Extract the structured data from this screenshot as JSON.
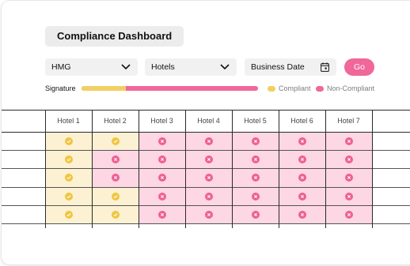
{
  "title": "Compliance Dashboard",
  "filters": {
    "brand": "HMG",
    "property": "Hotels",
    "date_placeholder": "Business Date"
  },
  "go_label": "Go",
  "signature": {
    "label": "Signature",
    "compliant_fraction": 0.25
  },
  "legend": {
    "compliant": "Compliant",
    "non_compliant": "Non-Compliant"
  },
  "colors": {
    "compliant": "#f2cf63",
    "non_compliant": "#f0679a",
    "compliant_bg": "#fcf1d2",
    "non_compliant_bg": "#fdd7e3"
  },
  "table": {
    "columns": [
      "Hotel 1",
      "Hotel 2",
      "Hotel 3",
      "Hotel 4",
      "Hotel 5",
      "Hotel 6",
      "Hotel 7"
    ],
    "rows": [
      [
        "compliant",
        "compliant",
        "non_compliant",
        "non_compliant",
        "non_compliant",
        "non_compliant",
        "non_compliant"
      ],
      [
        "compliant",
        "non_compliant",
        "non_compliant",
        "non_compliant",
        "non_compliant",
        "non_compliant",
        "non_compliant"
      ],
      [
        "compliant",
        "non_compliant",
        "non_compliant",
        "non_compliant",
        "non_compliant",
        "non_compliant",
        "non_compliant"
      ],
      [
        "compliant",
        "compliant",
        "non_compliant",
        "non_compliant",
        "non_compliant",
        "non_compliant",
        "non_compliant"
      ],
      [
        "compliant",
        "compliant",
        "non_compliant",
        "non_compliant",
        "non_compliant",
        "non_compliant",
        "non_compliant"
      ]
    ]
  }
}
